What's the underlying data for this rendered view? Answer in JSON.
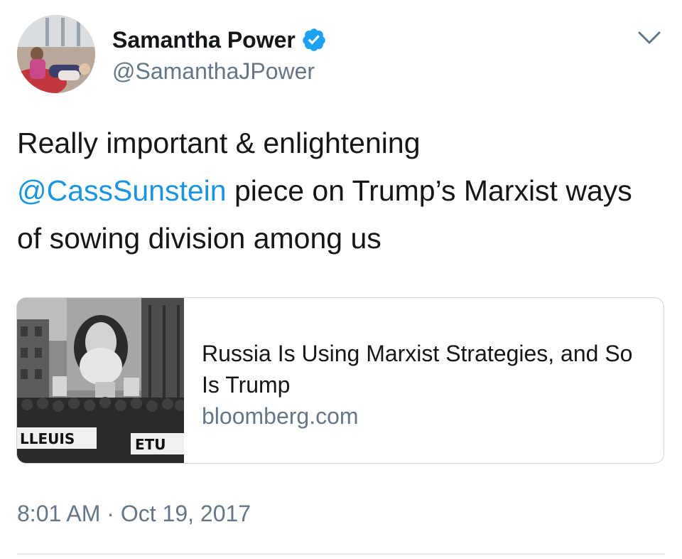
{
  "tweet": {
    "author": {
      "display_name": "Samantha Power",
      "handle": "@SamanthaJPower",
      "verified": true,
      "avatar_icon": "profile-photo"
    },
    "menu_icon": "chevron-down-icon",
    "text_lines": [
      {
        "text": "Really important & enlightening"
      },
      {
        "mention": "@CassSunstein",
        "text": " piece on Trump’s Marxist ways"
      },
      {
        "text": "of sowing division among us"
      }
    ],
    "card": {
      "title": "Russia Is Using Marxist Strategies, and So Is Trump",
      "domain": "bloomberg.com",
      "image_banner_left": "LLEUIS",
      "image_banner_right": "ETU"
    },
    "timestamp": "8:01 AM · Oct 19, 2017"
  },
  "colors": {
    "text": "#14171a",
    "secondary": "#657786",
    "link": "#1b95e0",
    "verified_badge": "#1da1f2",
    "border": "#ccd6dd"
  }
}
